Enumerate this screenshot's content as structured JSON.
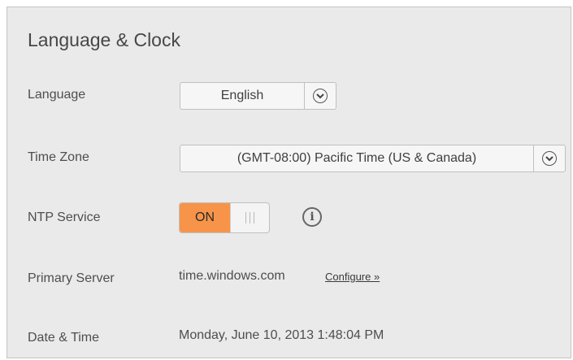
{
  "section": {
    "title": "Language & Clock"
  },
  "language": {
    "label": "Language",
    "value": "English"
  },
  "timezone": {
    "label": "Time Zone",
    "value": "(GMT-08:00) Pacific Time (US & Canada)"
  },
  "ntp": {
    "label": "NTP Service",
    "toggle_on_label": "ON",
    "state": "on",
    "accent_color": "#f7944a"
  },
  "primary_server": {
    "label": "Primary Server",
    "value": "time.windows.com",
    "configure_link": "Configure »"
  },
  "datetime": {
    "label": "Date & Time",
    "value": "Monday, June 10, 2013 1:48:04 PM"
  },
  "icons": {
    "dropdown": "chevron-down-icon",
    "info": "info-icon",
    "toggle_grip": "grip-icon"
  }
}
